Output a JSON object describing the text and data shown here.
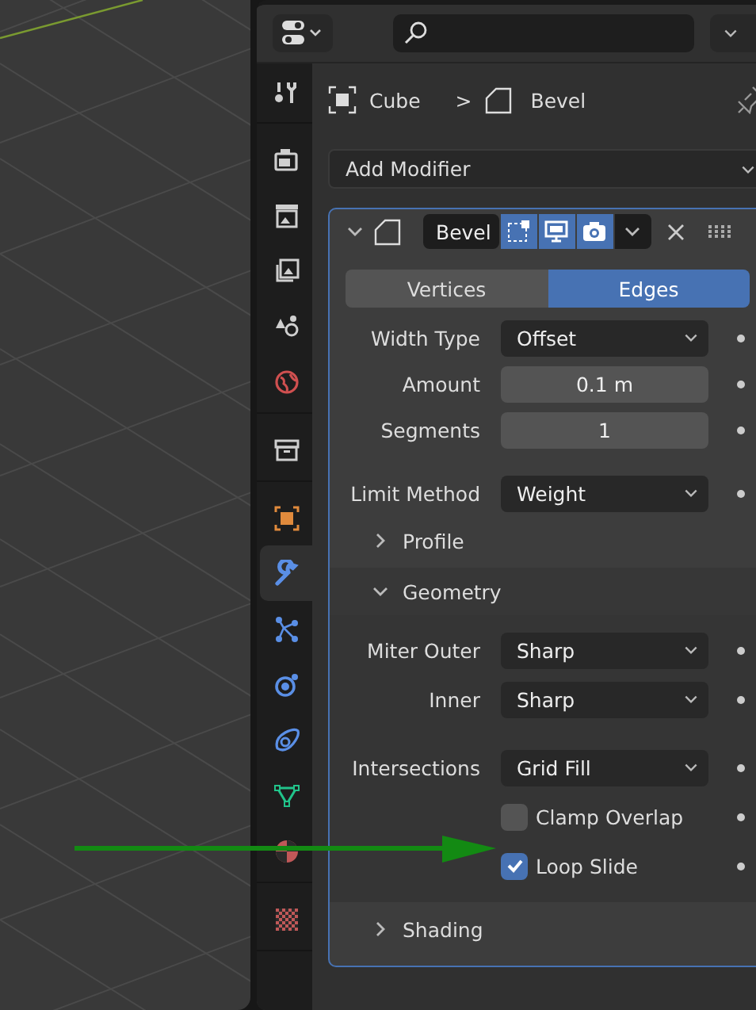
{
  "breadcrumb": {
    "object": "Cube",
    "separator": ">",
    "modifier": "Bevel"
  },
  "add_modifier": {
    "label": "Add Modifier"
  },
  "tab_groups": [
    [
      {
        "kind": "tool",
        "selected": false
      }
    ],
    [
      {
        "kind": "render",
        "selected": false
      },
      {
        "kind": "output",
        "selected": false
      },
      {
        "kind": "view-layer",
        "selected": false
      },
      {
        "kind": "scene",
        "selected": false
      },
      {
        "kind": "world",
        "selected": false
      }
    ],
    [
      {
        "kind": "collection",
        "selected": false
      }
    ],
    [
      {
        "kind": "object",
        "selected": false
      },
      {
        "kind": "modifier",
        "selected": true
      },
      {
        "kind": "particles",
        "selected": false
      },
      {
        "kind": "physics",
        "selected": false
      },
      {
        "kind": "constraints",
        "selected": false
      },
      {
        "kind": "data",
        "selected": false
      },
      {
        "kind": "material",
        "selected": false
      }
    ],
    [
      {
        "kind": "texture",
        "selected": false
      }
    ]
  ],
  "modifier": {
    "name": "Bevel",
    "expanded": true,
    "edit_mode": true,
    "viewport": true,
    "render": true,
    "affect_tabs": [
      {
        "label": "Vertices",
        "selected": false
      },
      {
        "label": "Edges",
        "selected": true
      }
    ],
    "groups": [
      [
        {
          "kind": "dropdown",
          "label": "Width Type",
          "value": "Offset"
        },
        {
          "kind": "number",
          "label": "Amount",
          "value": "0.1 m"
        },
        {
          "kind": "number",
          "label": "Segments",
          "value": "1"
        }
      ],
      [
        {
          "kind": "dropdown",
          "label": "Limit Method",
          "value": "Weight"
        }
      ]
    ],
    "subpanels": [
      {
        "title": "Profile",
        "expanded": false
      },
      {
        "title": "Geometry",
        "expanded": true,
        "groups": [
          [
            {
              "kind": "dropdown",
              "label": "Miter Outer",
              "value": "Sharp"
            },
            {
              "kind": "dropdown",
              "label": "Inner",
              "value": "Sharp"
            }
          ],
          [
            {
              "kind": "dropdown",
              "label": "Intersections",
              "value": "Grid Fill"
            },
            {
              "kind": "checkbox",
              "label": "Clamp Overlap",
              "checked": false
            },
            {
              "kind": "checkbox",
              "label": "Loop Slide",
              "checked": true
            }
          ]
        ]
      },
      {
        "title": "Shading",
        "expanded": false
      }
    ]
  }
}
